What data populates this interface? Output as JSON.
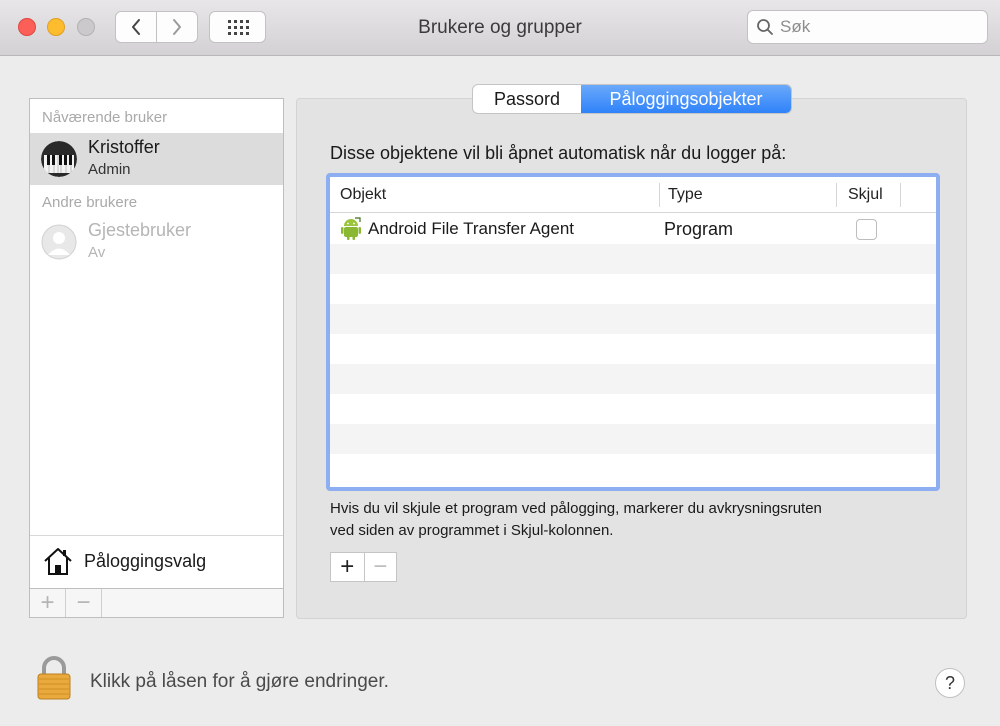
{
  "window": {
    "title": "Brukere og grupper"
  },
  "toolbar": {
    "back_icon": "chevron-left-icon",
    "forward_icon": "chevron-right-icon",
    "grid_icon": "grid-icon"
  },
  "search": {
    "placeholder": "Søk",
    "value": ""
  },
  "sidebar": {
    "current_section": "Nåværende bruker",
    "current_user": {
      "name": "Kristoffer",
      "role": "Admin"
    },
    "other_section": "Andre brukere",
    "other_users": [
      {
        "name": "Gjestebruker",
        "status": "Av"
      }
    ],
    "login_options_label": "Påloggingsvalg",
    "add_label": "+",
    "remove_label": "−"
  },
  "tabs": [
    {
      "label": "Passord",
      "active": false
    },
    {
      "label": "Påloggingsobjekter",
      "active": true
    }
  ],
  "main": {
    "intro": "Disse objektene vil bli åpnet automatisk når du logger på:",
    "columns": {
      "object": "Objekt",
      "type": "Type",
      "hide": "Skjul"
    },
    "rows": [
      {
        "name": "Android File Transfer Agent",
        "type": "Program",
        "hidden": false,
        "icon": "android-icon"
      }
    ],
    "hint_line1": "Hvis du vil skjule et program ved pålogging, markerer du avkrysningsruten",
    "hint_line2": "ved siden av programmet i Skjul-kolonnen.",
    "add_label": "+",
    "remove_label": "−"
  },
  "footer": {
    "lock_text": "Klikk på låsen for å gjøre endringer.",
    "help_label": "?"
  },
  "colors": {
    "accent": "#2f82f9",
    "table_focus": "#8daef0",
    "selection": "#dcdcdc"
  }
}
